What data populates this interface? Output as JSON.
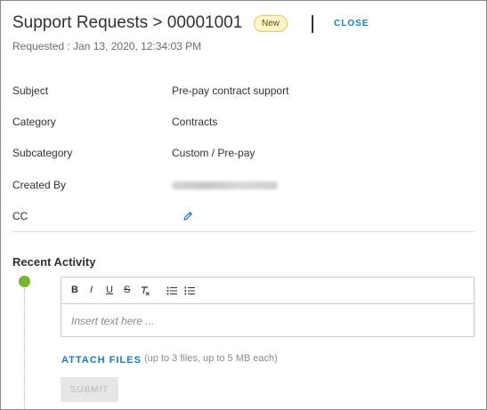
{
  "header": {
    "title": "Support Requests > 00001001",
    "status_badge": "New",
    "close_label": "CLOSE",
    "requested": "Requested : Jan 13, 2020, 12:34:03 PM"
  },
  "details": {
    "subject_label": "Subject",
    "subject_value": "Pre-pay contract support",
    "category_label": "Category",
    "category_value": "Contracts",
    "subcategory_label": "Subcategory",
    "subcategory_value": "Custom / Pre-pay",
    "created_by_label": "Created By",
    "cc_label": "CC"
  },
  "activity": {
    "title": "Recent Activity",
    "toolbar": {
      "bold": "B",
      "italic": "I",
      "underline": "U",
      "strike": "S"
    },
    "editor_placeholder": "Insert text here ...",
    "attach_label": "ATTACH FILES",
    "attach_hint": "(up to 3 files, up to 5 MB each)",
    "submit_label": "SUBMIT"
  },
  "colors": {
    "link": "#1f7ab8",
    "badge_bg": "#fff5c7",
    "badge_border": "#e7c85b",
    "timeline_dot": "#77b82a"
  },
  "icons": [
    "pencil-icon",
    "clear-format-icon",
    "bulleted-list-icon",
    "numbered-list-icon"
  ]
}
